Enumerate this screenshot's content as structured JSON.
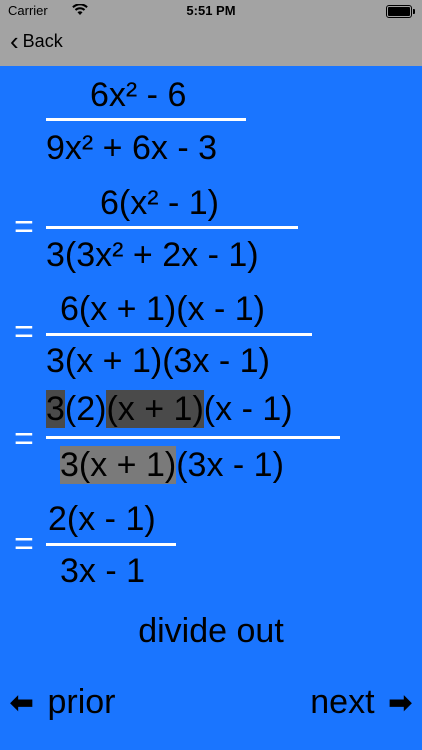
{
  "status": {
    "carrier": "Carrier",
    "time": "5:51 PM"
  },
  "nav": {
    "back_label": "Back"
  },
  "steps": [
    {
      "eq": "",
      "num": "6x² - 6",
      "den": "9x² + 6x - 3"
    },
    {
      "eq": "=",
      "num": "6(x² - 1)",
      "den": "3(3x² + 2x - 1)"
    },
    {
      "eq": "=",
      "num": "6(x + 1)(x - 1)",
      "den": "3(x + 1)(3x - 1)"
    },
    {
      "eq": "=",
      "num_parts": [
        "3",
        "(2)",
        "(x + 1)",
        "(x - 1)"
      ],
      "den_parts": [
        "3(x + 1)",
        "(3x - 1)"
      ]
    },
    {
      "eq": "=",
      "num": "2(x - 1)",
      "den": "3x - 1"
    }
  ],
  "caption": "divide out",
  "buttons": {
    "prior": "prior",
    "next": "next"
  }
}
